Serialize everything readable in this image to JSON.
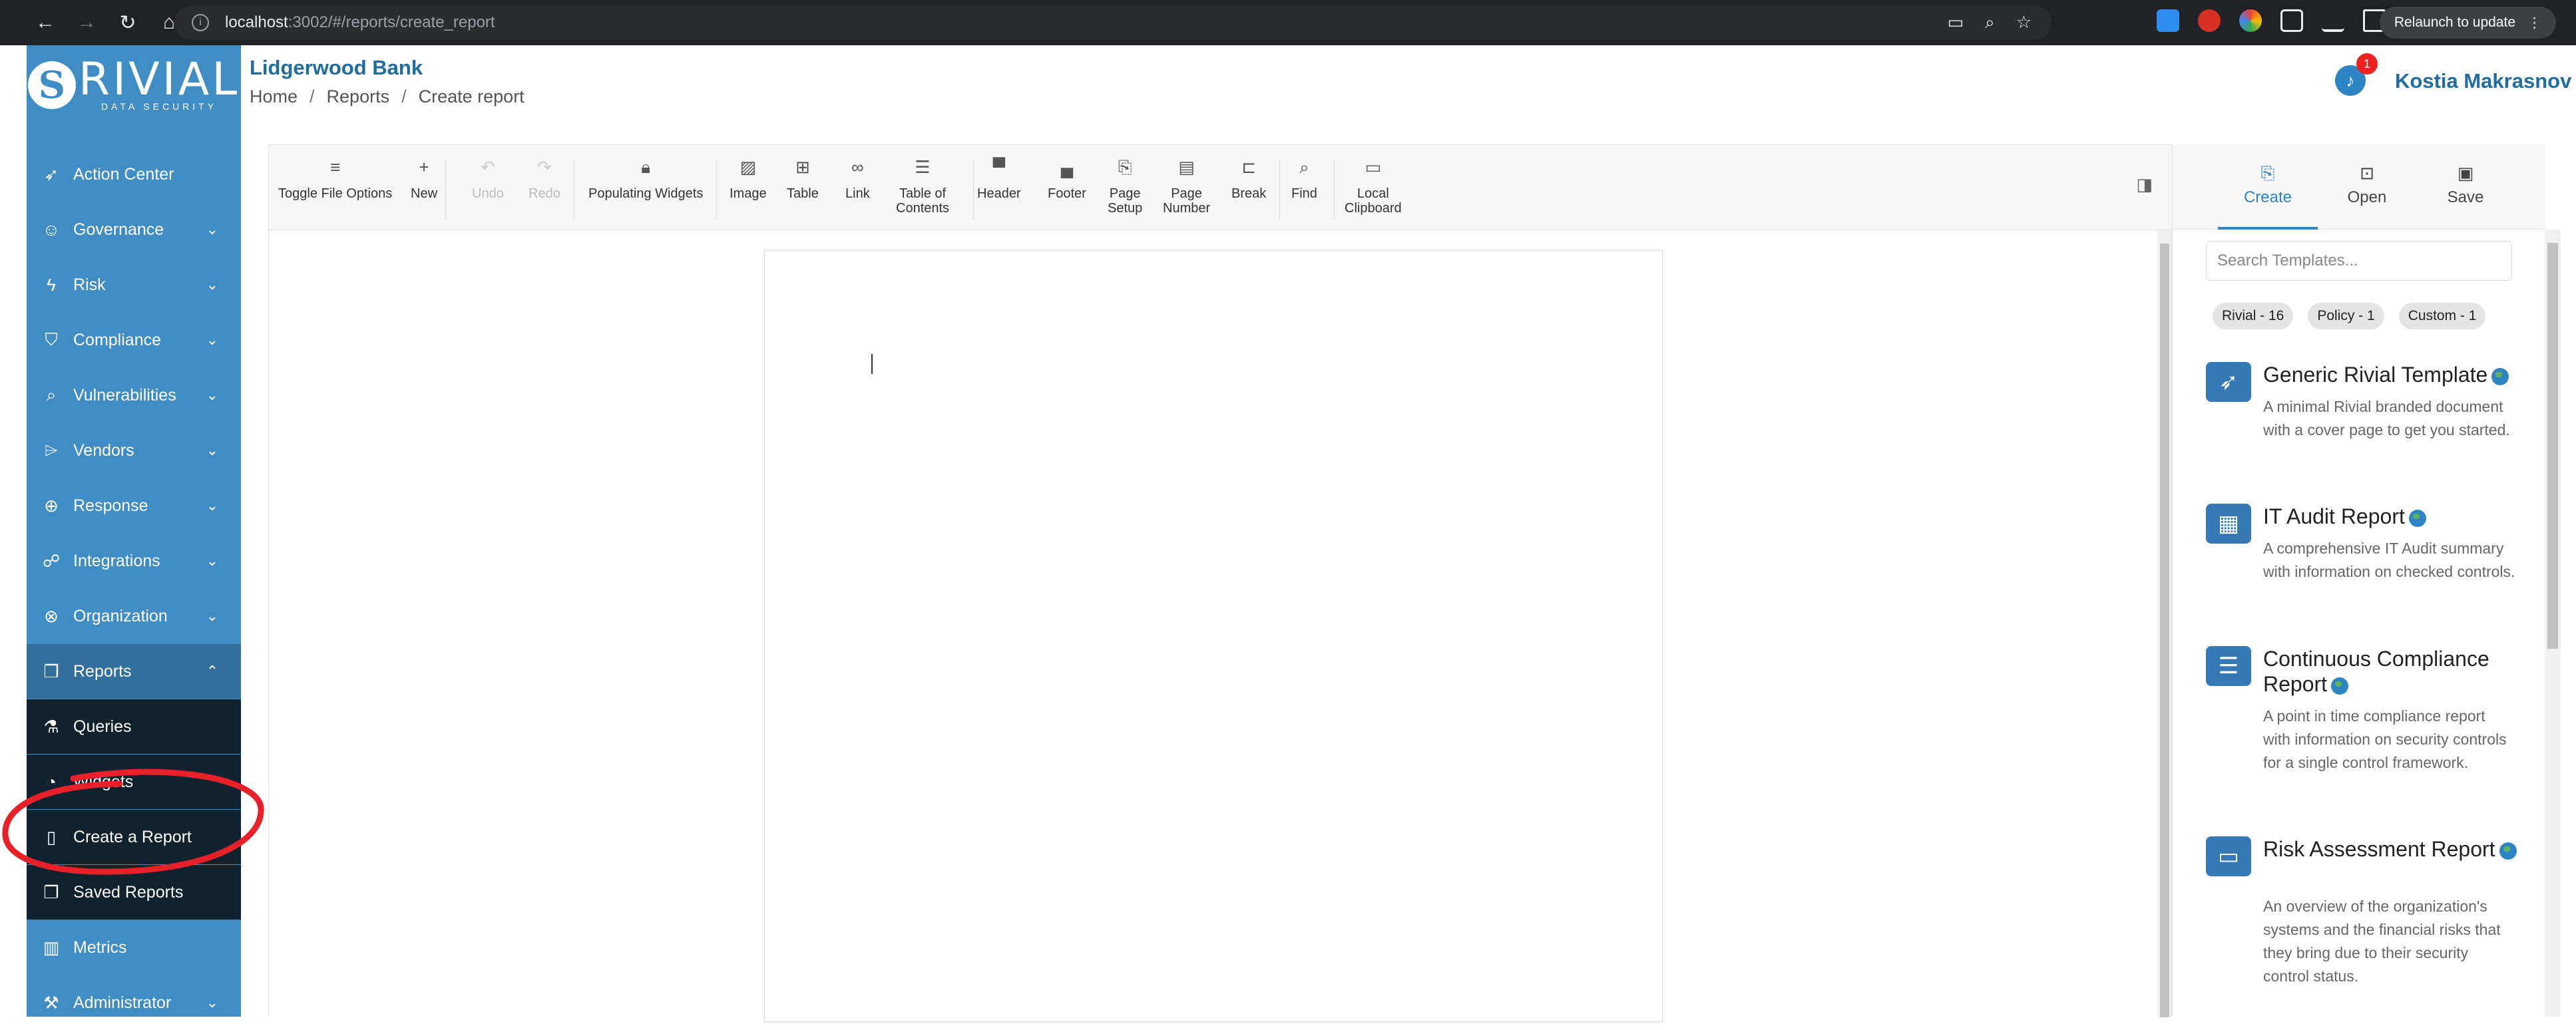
{
  "browser": {
    "url_host": "localhost",
    "url_rest": ":3002/#/reports/create_report",
    "relaunch_label": "Relaunch to update"
  },
  "sidebar": {
    "logo_text": "RIVIAL",
    "logo_sub": "DATA SECURITY",
    "items": [
      {
        "label": "Action Center"
      },
      {
        "label": "Governance"
      },
      {
        "label": "Risk"
      },
      {
        "label": "Compliance"
      },
      {
        "label": "Vulnerabilities"
      },
      {
        "label": "Vendors"
      },
      {
        "label": "Response"
      },
      {
        "label": "Integrations"
      },
      {
        "label": "Organization"
      },
      {
        "label": "Reports"
      },
      {
        "label": "Queries"
      },
      {
        "label": "Widgets"
      },
      {
        "label": "Create a Report"
      },
      {
        "label": "Saved Reports"
      },
      {
        "label": "Metrics"
      },
      {
        "label": "Administrator"
      }
    ]
  },
  "header": {
    "org": "Lidgerwood Bank",
    "breadcrumb": [
      "Home",
      "Reports",
      "Create report"
    ],
    "separator": "/",
    "notifications": "1",
    "user": "Kostia Makrasnov"
  },
  "toolbar": {
    "toggle": "Toggle File Options",
    "new": "New",
    "undo": "Undo",
    "redo": "Redo",
    "populating": "Populating Widgets",
    "image": "Image",
    "table": "Table",
    "link": "Link",
    "toc1": "Table of",
    "toc2": "Contents",
    "header": "Header",
    "footer": "Footer",
    "setup1": "Page",
    "setup2": "Setup",
    "number1": "Page",
    "number2": "Number",
    "break": "Break",
    "find": "Find",
    "clip1": "Local",
    "clip2": "Clipboard"
  },
  "panel": {
    "tabs": {
      "create": "Create",
      "open": "Open",
      "save": "Save"
    },
    "search_placeholder": "Search Templates...",
    "chips": [
      "Rivial - 16",
      "Policy - 1",
      "Custom - 1"
    ],
    "templates": [
      {
        "title": "Generic Rivial Template",
        "desc": "A minimal Rivial branded document with a cover page to get you started.",
        "icon": "rocket-icon"
      },
      {
        "title": "IT Audit Report",
        "desc": "A comprehensive IT Audit summary with information on checked controls.",
        "icon": "film-icon"
      },
      {
        "title": "Continuous Compliance Report",
        "desc": "A point in time compliance report with information on security controls for a single control framework.",
        "icon": "list-icon"
      },
      {
        "title": "Risk Assessment Report",
        "desc": "An overview of the organization's systems and the financial risks that they bring due to their security control status.",
        "icon": "monitor-icon"
      }
    ]
  },
  "colors": {
    "sidebar": "#3f8dc4",
    "accent": "#1f6c9f",
    "annotation": "#e8202a"
  }
}
